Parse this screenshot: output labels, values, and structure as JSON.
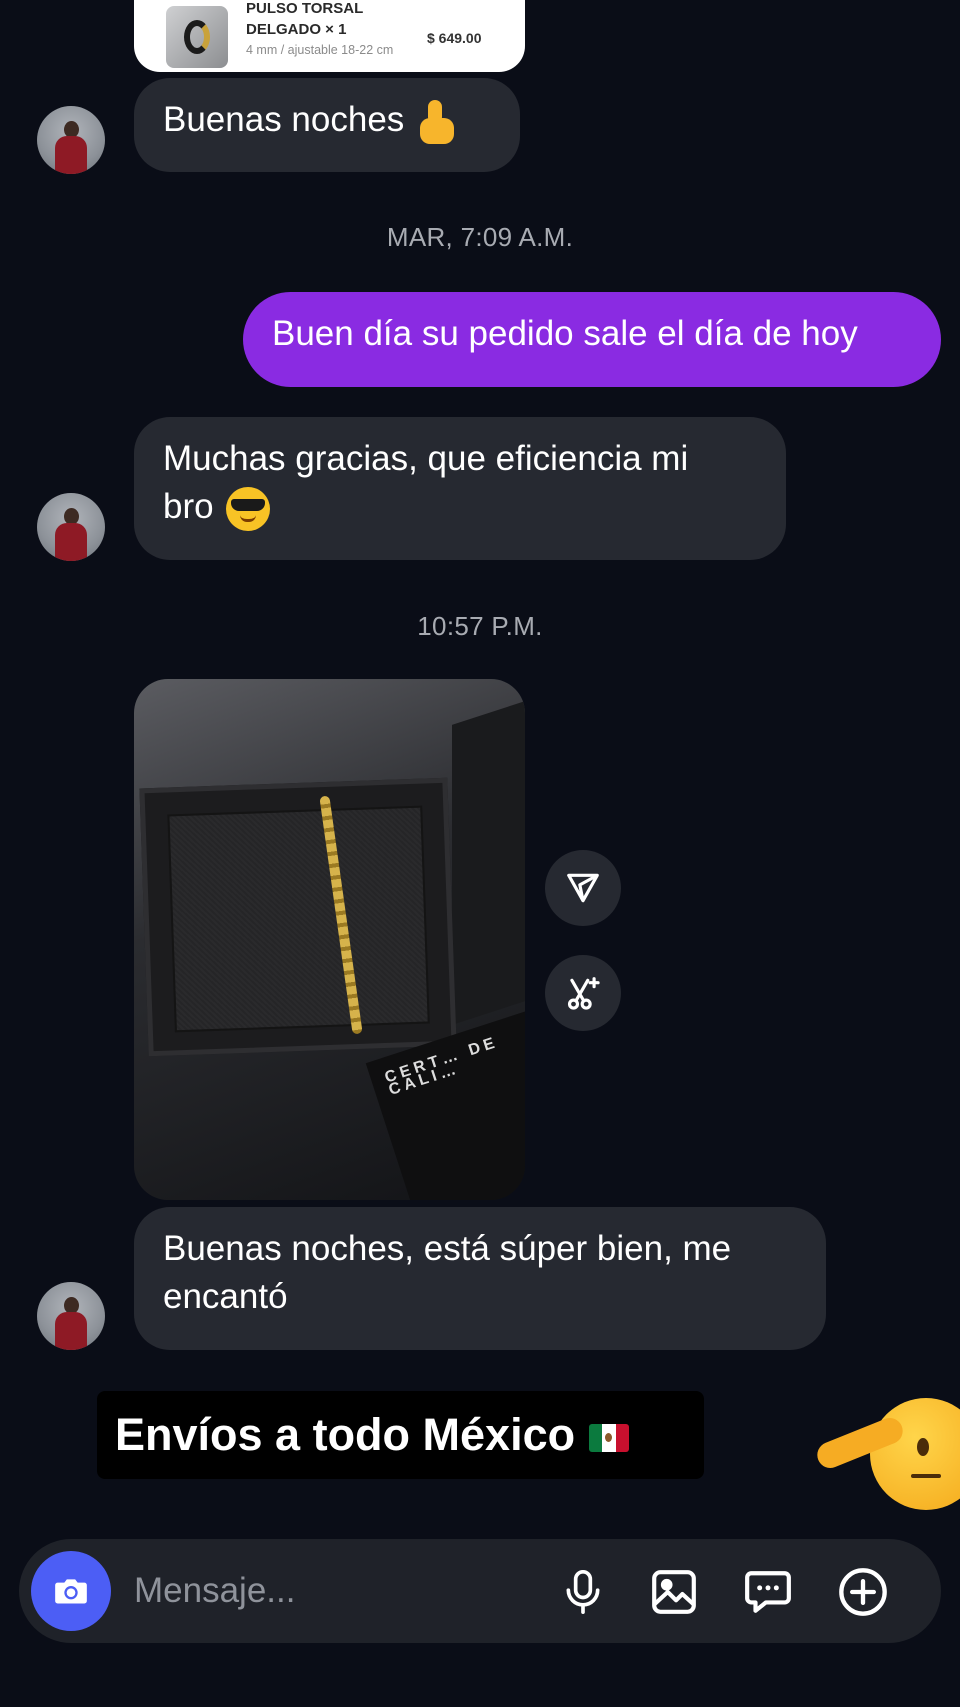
{
  "product": {
    "name": "PULSO TORSAL DELGADO × 1",
    "variant": "4 mm / ajustable 18-22 cm",
    "price": "$ 649.00"
  },
  "messages": [
    {
      "id": "m1",
      "direction": "incoming",
      "text": "Buenas noches",
      "emoji": "thumbs-up"
    },
    {
      "id": "t1",
      "type": "timestamp",
      "text": "MAR, 7:09 A.M."
    },
    {
      "id": "m2",
      "direction": "outgoing",
      "text": "Buen día su pedido sale el día de hoy"
    },
    {
      "id": "m3",
      "direction": "incoming",
      "text_line1": "Muchas gracias, que eficiencia mi",
      "text_line2": "bro",
      "emoji": "smiling-face-with-sunglasses"
    },
    {
      "id": "t2",
      "type": "timestamp",
      "text": "10:57 P.M."
    },
    {
      "id": "m4",
      "direction": "incoming",
      "type": "photo",
      "photo_caption_text": "CERT… DE CALI…"
    },
    {
      "id": "m5",
      "direction": "incoming",
      "text_line1": "Buenas noches, está súper bien, me",
      "text_line2": "encantó"
    }
  ],
  "photo_actions": [
    {
      "icon": "send-icon"
    },
    {
      "icon": "scissors-sparkle-icon"
    }
  ],
  "sticker": {
    "text": "Envíos a todo México",
    "flag": "mexico-flag",
    "emoji": "saluting-face"
  },
  "composer": {
    "placeholder": "Mensaje...",
    "icons": [
      "camera-icon",
      "microphone-icon",
      "gallery-icon",
      "sticker-chat-icon",
      "add-icon"
    ]
  },
  "colors": {
    "background": "#0a0d17",
    "incoming_bubble": "#262931",
    "outgoing_bubble": "#8a2be2",
    "camera_button": "#4c5ef5"
  }
}
